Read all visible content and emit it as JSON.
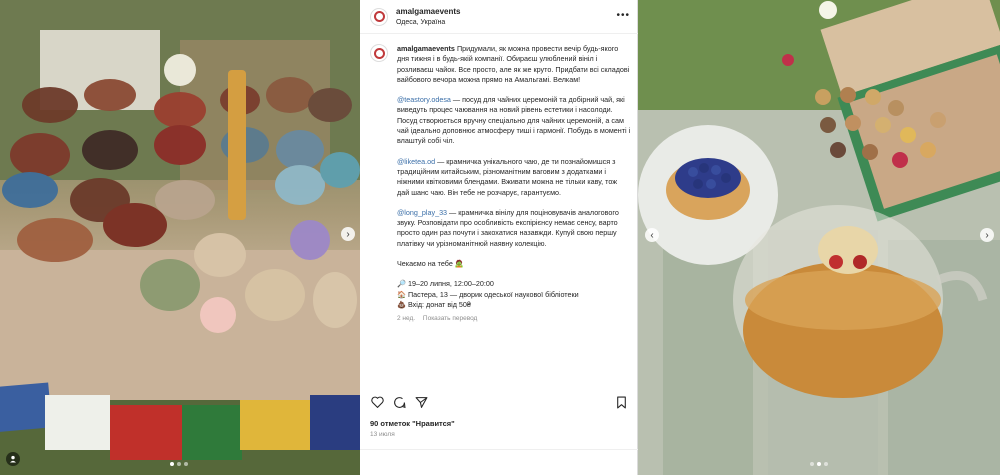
{
  "post": {
    "username": "amalgamaevents",
    "location": "Одеса, Україна",
    "intro": "Придумали, як можна провести вечір будь-якого дня тижня і в будь-якій компанії. Обираєш улюблений вініл і розливаєш чайок. Все просто, але як же круто. Придбати всі складові вайбового вечора можна прямо на Амальгамі. Велкам!",
    "p1_mention": "@teastory.odesa",
    "p1_text": " — посуд для чайних церемоній та добірний чай, які виведуть процес чаювання на новий рівень естетики і насолоди. Посуд створюється вручну спеціально для чайних церемоній, а сам чай ідеально доповнює атмосферу тиші і гармонії. Побудь в моменті і влаштуй собі чіл.",
    "p2_mention": "@liketea.od",
    "p2_text": " — крамничка унікального чаю, де ти познайомишся з традиційним китайським, різноманітним ваговим з додатками і ніжними квітковими блендами. Вживати можна не тільки каву, тож дай шанс чаю. Він тебе не розчарує, гарантуємо.",
    "p3_mention": "@long_play_33",
    "p3_text": " — крамничка вінілу для поціновувачів аналогового звуку. Розповідати про особливість експірієнсу немає сенсу, варто просто один раз почути і закохатися назавжди. Купуй свою першу платівку чи урізноманітнюй наявну колекцію.",
    "closing": "Чекаємо на тебе 🧟",
    "ev1": "🔎 19–20 липня, 12:00–20:00",
    "ev2": "🏠 Пастера, 13 — дворик одеської наукової бібліотеки",
    "ev3": "💩 Вхід: донат від 50₴",
    "age": "2 нед.",
    "translate": "Показать перевод",
    "likes": "90 отметок \"Нравится\"",
    "date": "13 июля"
  },
  "icons": {
    "more": "more-icon",
    "heart": "heart-icon",
    "comment": "comment-icon",
    "share": "share-icon",
    "bookmark": "bookmark-icon",
    "chevron_left": "chevron-left-icon",
    "chevron_right": "chevron-right-icon",
    "user": "user-icon"
  },
  "colors": {
    "accent": "#c0393b",
    "mention": "#3b6fa8",
    "muted": "#8e8e8e"
  }
}
